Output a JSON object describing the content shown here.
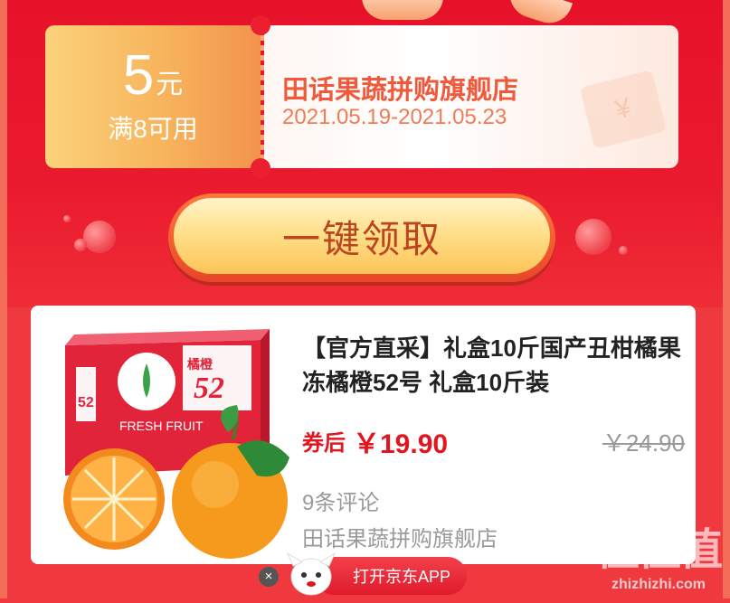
{
  "coupon": {
    "amount": "5",
    "unit": "元",
    "condition": "满8可用",
    "shop_name": "田话果蔬拼购旗舰店",
    "date_range": "2021.05.19-2021.05.23"
  },
  "claim_button": {
    "label": "一键领取"
  },
  "product": {
    "title": "【官方直采】礼盒10斤国产丑柑橘果冻橘橙52号 礼盒10斤装",
    "price_label": "券后",
    "price": "￥19.90",
    "original_price": "￥24.90",
    "review_count": "9条评论",
    "store_name": "田话果蔬拼购旗舰店",
    "image_text": {
      "fresh_fruit": "FRESH FRUIT",
      "brand_number": "52",
      "brand_char": "橘橙"
    }
  },
  "bottom_bar": {
    "open_app_label": "打开京东APP",
    "close_symbol": "×"
  },
  "watermark": {
    "main": "值值值",
    "site": "zhizhizhi.com"
  },
  "colors": {
    "accent": "#e4151f",
    "coupon_text": "#ef5a3c",
    "background": "#ea1a2e"
  }
}
